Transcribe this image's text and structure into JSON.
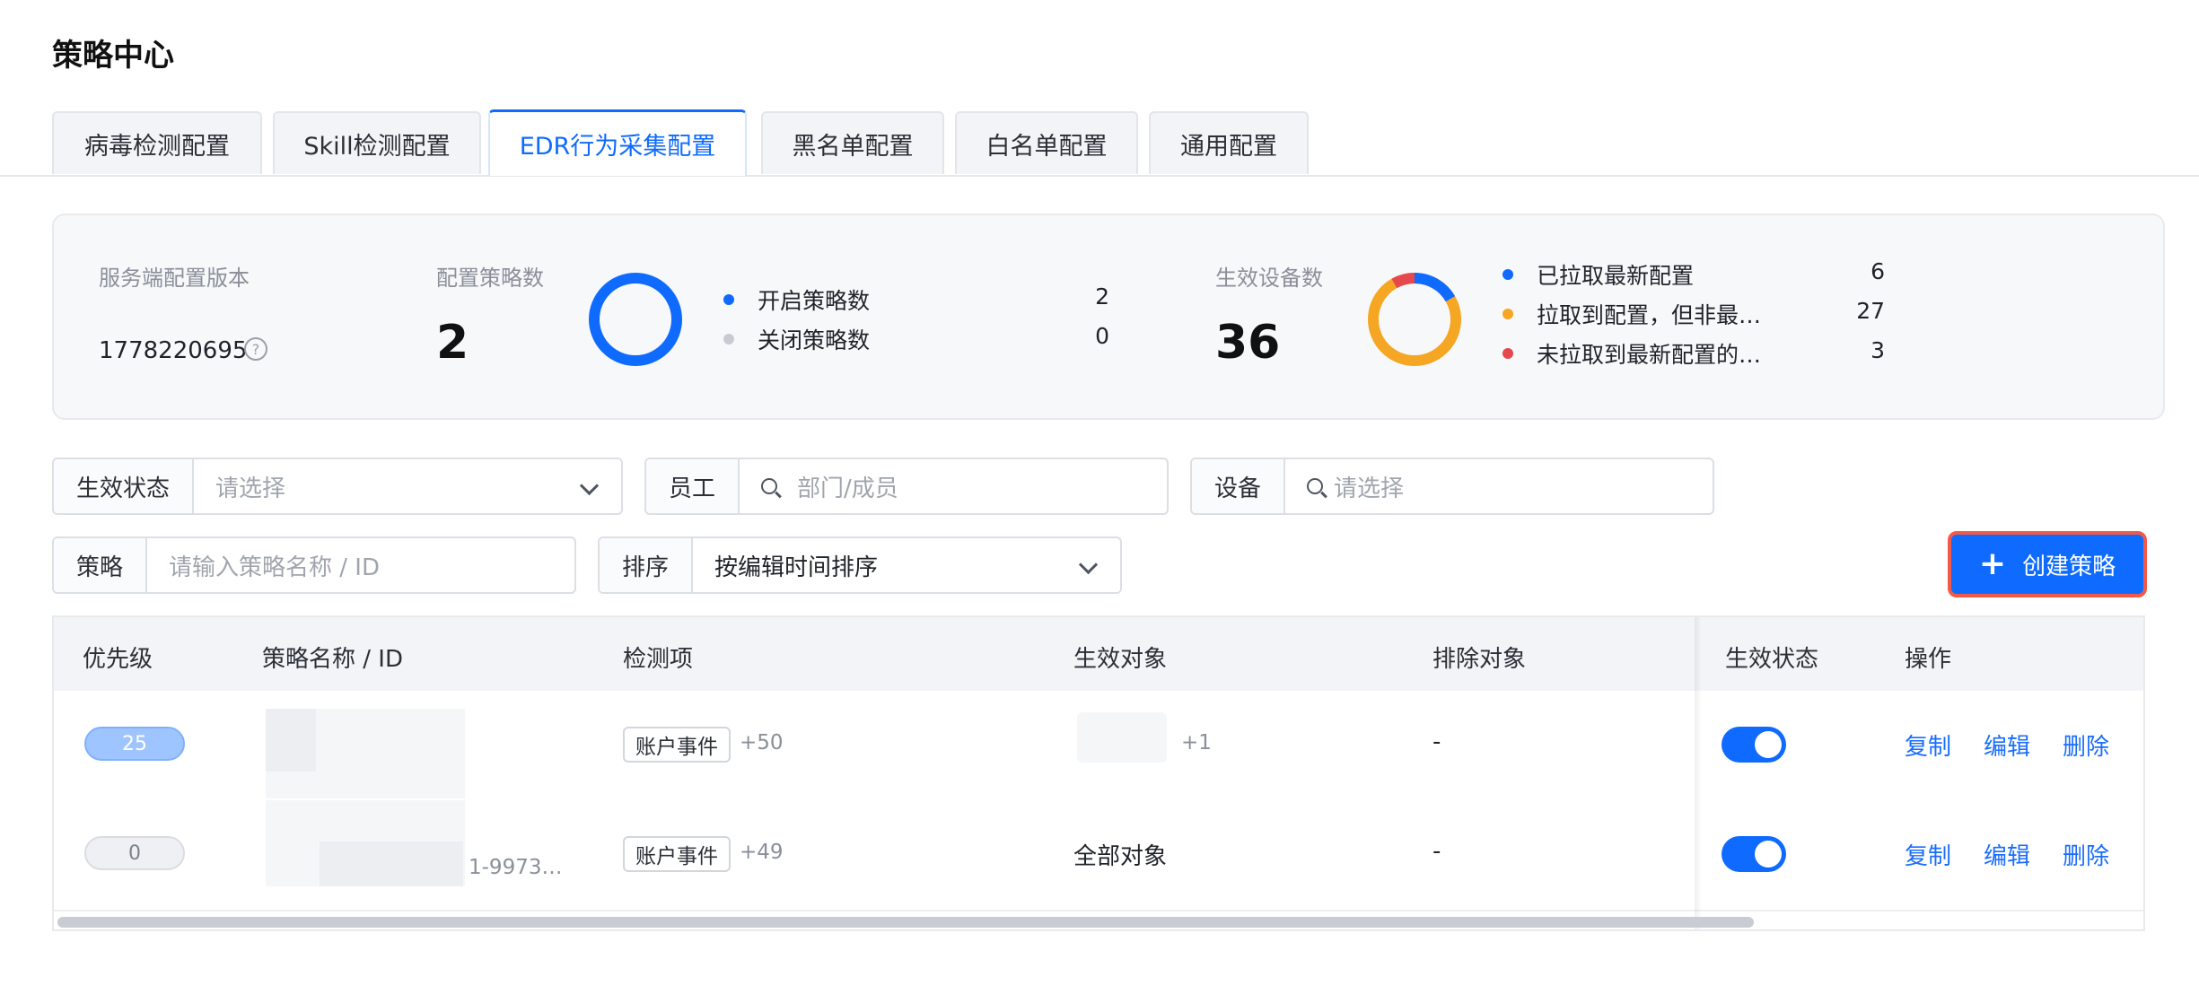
{
  "page_title": "策略中心",
  "tabs": [
    {
      "label": "病毒检测配置"
    },
    {
      "label": "Skill检测配置"
    },
    {
      "label": "EDR行为采集配置",
      "active": true
    },
    {
      "label": "黑名单配置"
    },
    {
      "label": "白名单配置"
    },
    {
      "label": "通用配置"
    }
  ],
  "summary": {
    "version_label": "服务端配置版本",
    "version_value": "1778220695",
    "help_icon": "?",
    "policy_count_label": "配置策略数",
    "policy_count": "2",
    "policy_legend": [
      {
        "label": "开启策略数",
        "value": "2",
        "color": "#0f6bff"
      },
      {
        "label": "关闭策略数",
        "value": "0",
        "color": "#c8ccd2"
      }
    ],
    "device_count_label": "生效设备数",
    "device_count": "36",
    "device_legend": [
      {
        "label": "已拉取最新配置",
        "value": "6",
        "color": "#0f6bff"
      },
      {
        "label": "拉取到配置，但非最…",
        "value": "27",
        "color": "#f5a623"
      },
      {
        "label": "未拉取到最新配置的…",
        "value": "3",
        "color": "#e5484d"
      }
    ]
  },
  "filters": {
    "status": {
      "label": "生效状态",
      "placeholder": "请选择"
    },
    "employee": {
      "label": "员工",
      "placeholder": "部门/成员"
    },
    "device": {
      "label": "设备",
      "placeholder": "请选择"
    },
    "policy": {
      "label": "策略",
      "placeholder": "请输入策略名称 / ID"
    },
    "sort": {
      "label": "排序",
      "value": "按编辑时间排序"
    }
  },
  "create_button": {
    "icon": "+",
    "label": "创建策略"
  },
  "table": {
    "headers": [
      "优先级",
      "策略名称 / ID",
      "检测项",
      "生效对象",
      "排除对象",
      "生效状态",
      "操作"
    ],
    "rows": [
      {
        "priority": "25",
        "id_tail": "",
        "detect_tag": "账户事件",
        "detect_more": "+50",
        "target": "",
        "target_more": "+1",
        "exclude": "-",
        "enabled": true,
        "ops": [
          "复制",
          "编辑",
          "删除"
        ]
      },
      {
        "priority": "0",
        "id_tail": "1-9973…",
        "detect_tag": "账户事件",
        "detect_more": "+49",
        "target": "全部对象",
        "target_more": "",
        "exclude": "-",
        "enabled": true,
        "ops": [
          "复制",
          "编辑",
          "删除"
        ]
      }
    ]
  }
}
